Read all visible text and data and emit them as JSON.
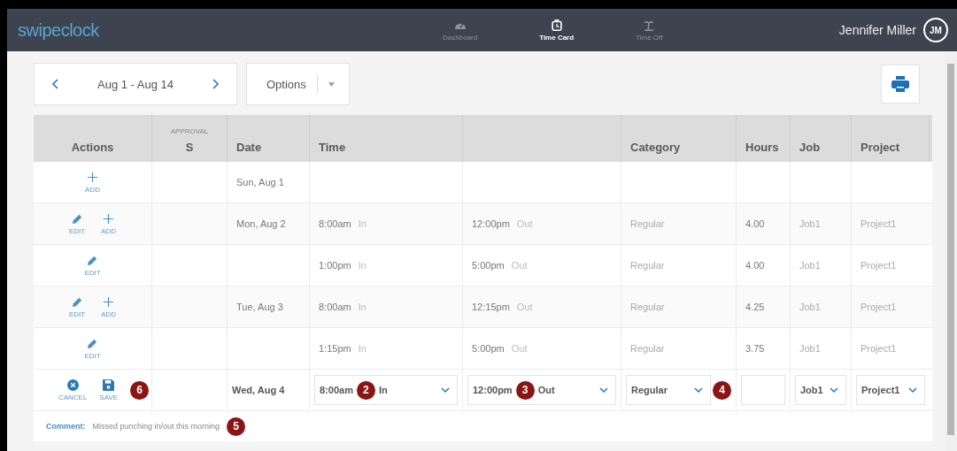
{
  "header": {
    "logo": "swipeclock",
    "nav": [
      {
        "label": "Dashboard",
        "selected": false
      },
      {
        "label": "Time Card",
        "selected": true
      },
      {
        "label": "Time Off",
        "selected": false
      }
    ],
    "user": {
      "name": "Jennifer Miller",
      "initials": "JM"
    }
  },
  "toolbar": {
    "range": "Aug 1 - Aug 14",
    "options": "Options"
  },
  "table": {
    "columns": [
      {
        "label": "Actions"
      },
      {
        "label": "S",
        "sub": "APPROVAL"
      },
      {
        "label": "Date"
      },
      {
        "label": "Time"
      },
      {},
      {
        "label": "Category"
      },
      {
        "label": "Hours"
      },
      {
        "label": "Job"
      },
      {
        "label": "Project"
      }
    ],
    "rows": [
      {
        "actions": [
          {
            "kind": "add",
            "label": "ADD"
          }
        ],
        "date": "Sun, Aug 1"
      },
      {
        "actions": [
          {
            "kind": "edit",
            "label": "EDIT"
          },
          {
            "kind": "add",
            "label": "ADD"
          }
        ],
        "date": "Mon, Aug 2",
        "in": "8:00am",
        "in_label": "In",
        "out": "12:00pm",
        "out_label": "Out",
        "category": "Regular",
        "hours": "4.00",
        "job": "Job1",
        "project": "Project1"
      },
      {
        "actions": [
          {
            "kind": "edit",
            "label": "EDIT"
          }
        ],
        "date": "",
        "in": "1:00pm",
        "in_label": "In",
        "out": "5:00pm",
        "out_label": "Out",
        "category": "Regular",
        "hours": "4.00",
        "job": "Job1",
        "project": "Project1"
      },
      {
        "actions": [
          {
            "kind": "edit",
            "label": "EDIT"
          },
          {
            "kind": "add",
            "label": "ADD"
          }
        ],
        "date": "Tue, Aug 3",
        "in": "8:00am",
        "in_label": "In",
        "out": "12:15pm",
        "out_label": "Out",
        "category": "Regular",
        "hours": "4.25",
        "job": "Job1",
        "project": "Project1"
      },
      {
        "actions": [
          {
            "kind": "edit",
            "label": "EDIT"
          }
        ],
        "date": "",
        "in": "1:15pm",
        "in_label": "In",
        "out": "5:00pm",
        "out_label": "Out",
        "category": "Regular",
        "hours": "3.75",
        "job": "Job1",
        "project": "Project1"
      }
    ],
    "edit_row": {
      "cancel": "CANCEL",
      "save": "SAVE",
      "save_badge": "6",
      "date": "Wed, Aug 4",
      "in": "8:00am",
      "in_badge": "2",
      "in_type": "In",
      "out": "12:00pm",
      "out_badge": "3",
      "out_type": "Out",
      "category": "Regular",
      "category_badge": "4",
      "job": "Job1",
      "project": "Project1"
    },
    "comment": {
      "label": "Comment:",
      "text": "Missed punching in/out this morning",
      "badge": "5"
    }
  }
}
